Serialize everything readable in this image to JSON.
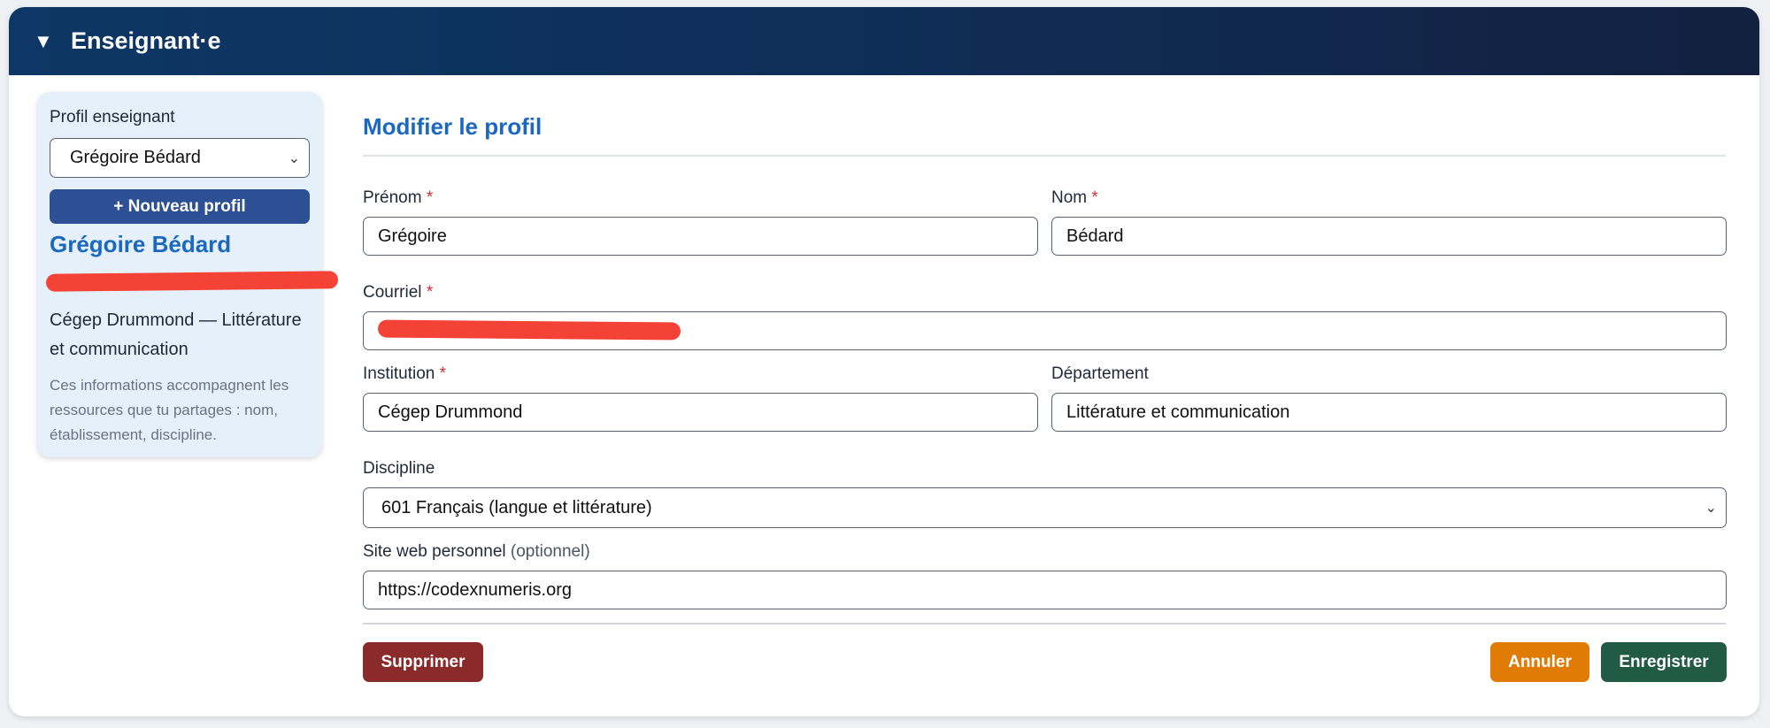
{
  "header": {
    "title": "Enseignant·e",
    "collapse_icon": "▼"
  },
  "sidebar": {
    "profile_label": "Profil enseignant",
    "selected_profile": "Grégoire Bédard",
    "new_profile_label": "+ Nouveau profil",
    "name": "Grégoire Bédard",
    "institution_line": "Cégep Drummond — Littérature et communication",
    "note": "Ces informations accompagnent les ressources que tu partages : nom, établissement, discipline."
  },
  "form": {
    "title": "Modifier le profil",
    "required_mark": "*",
    "first_name": {
      "label": "Prénom",
      "value": "Grégoire"
    },
    "last_name": {
      "label": "Nom",
      "value": "Bédard"
    },
    "email": {
      "label": "Courriel",
      "value": ""
    },
    "institution": {
      "label": "Institution",
      "value": "Cégep Drummond"
    },
    "department": {
      "label": "Département",
      "value": "Littérature et communication"
    },
    "discipline": {
      "label": "Discipline",
      "value": "601 Français (langue et littérature)"
    },
    "website": {
      "label": "Site web personnel",
      "optional": "(optionnel)",
      "value": "https://codexnumeris.org"
    }
  },
  "actions": {
    "delete_label": "Supprimer",
    "cancel_label": "Annuler",
    "save_label": "Enregistrer"
  },
  "colors": {
    "header": "#0f2e57",
    "accent": "#1a68c0",
    "delete": "#8b2a2a",
    "cancel": "#e07b06",
    "save": "#215b46",
    "redaction": "#f44336"
  }
}
